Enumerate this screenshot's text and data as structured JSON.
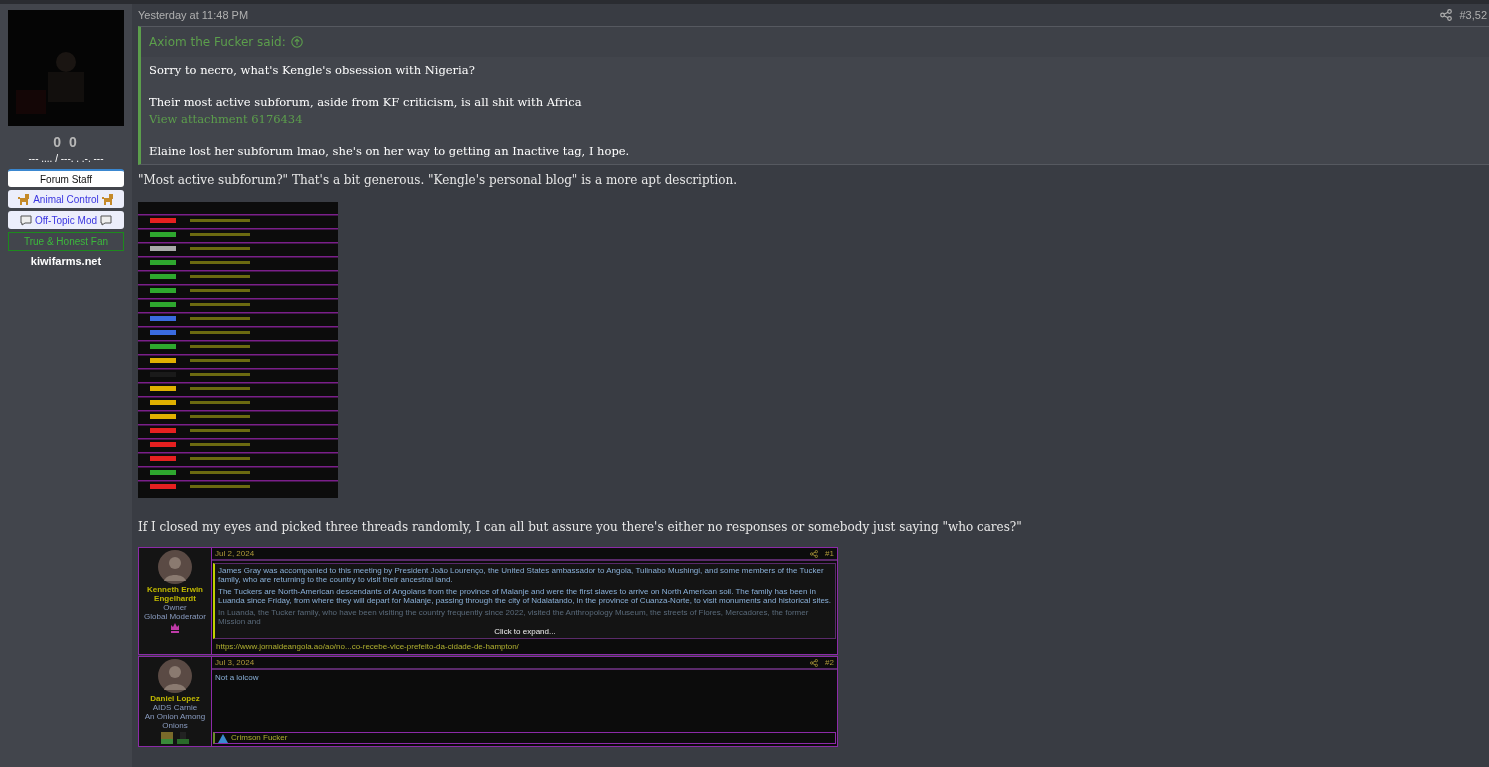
{
  "user": {
    "stats": "0 0",
    "rank_line": "--- .... / ---. . .-. ---",
    "banners": [
      {
        "kind": "staff",
        "label": "Forum Staff"
      },
      {
        "kind": "animal",
        "label": "Animal Control"
      },
      {
        "kind": "chat",
        "label": "Off-Topic Mod"
      },
      {
        "kind": "fan",
        "label": "True & Honest Fan"
      }
    ],
    "site": "kiwifarms.net"
  },
  "post": {
    "time": "Yesterday at 11:48 PM",
    "number": "#3,52",
    "quote": {
      "author": "Axiom the Fucker said:",
      "lines": [
        "Sorry to necro, what's Kengle's obsession with Nigeria?",
        "Their most active subforum, aside from KF criticism, is all shit with Africa"
      ],
      "attachment": "View attachment 6176434",
      "tail": "Elaine lost her subforum lmao, she's on her way to getting an Inactive tag, I hope."
    },
    "body": [
      {
        "kind": "text",
        "text": "\"Most active subforum?\" That's a bit generous. \"Kengle's personal blog\" is a more apt description."
      },
      {
        "kind": "picture"
      },
      {
        "kind": "text",
        "text": "If I closed my eyes and picked three threads randomly, I can all but assure you there's either no responses or somebody just saying \"who cares?\""
      },
      {
        "kind": "embed",
        "posts": [
          {
            "name": "Kenneth Erwin Engelhardt",
            "titles": [
              "Owner",
              "Global Moderator"
            ],
            "date": "Jul 2, 2024",
            "number": "#1",
            "quote": [
              "James Gray was accompanied to this meeting by President João Lourenço, the United States ambassador to Angola, Tulinabo Mushingi, and some members of the Tucker family, who are returning to the country to visit their ancestral land.",
              "The Tuckers are North-American descendants of Angolans from the province of Malanje and were the first slaves to arrive on North American soil. The family has been in Luanda since Friday, from where they will depart for Malanje, passing through the city of Ndalatando, in the province of Cuanza-Norte, to visit monuments and historical sites.",
              "In Luanda, the Tucker family, who have been visiting the country frequently since 2022, visited the Anthropology Museum, the streets of Flores, Mercadores, the former Mission and"
            ],
            "expand": "Click to expand...",
            "link": "https://www.jornaldeangola.ao/ao/no...co-recebe-vice-prefeito-da-cidade-de-hampton/"
          },
          {
            "name": "Daniel Lopez",
            "titles": [
              "AIDS Carnie",
              "An Onion Among Onions"
            ],
            "date": "Jul 3, 2024",
            "number": "#2",
            "text": "Not a lolcow",
            "reaction": "Crimson Fucker"
          }
        ]
      }
    ]
  }
}
